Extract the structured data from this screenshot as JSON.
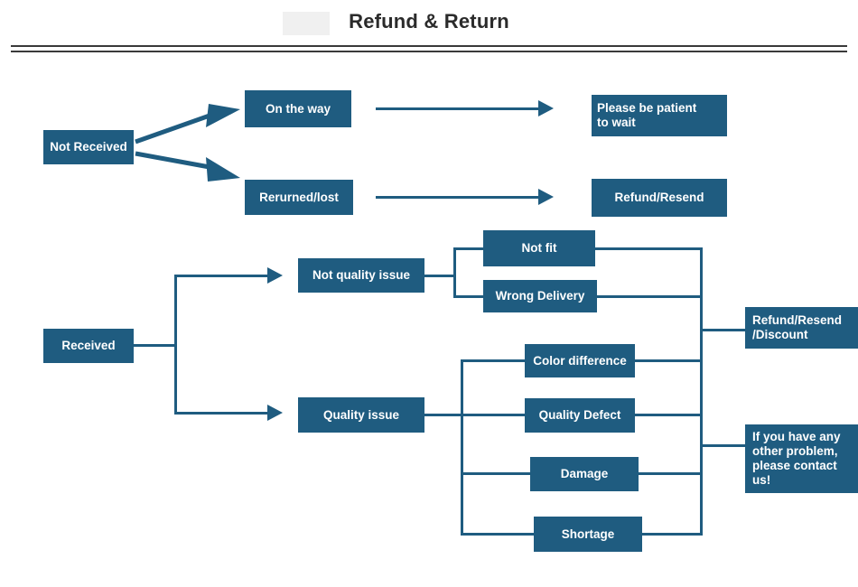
{
  "header": {
    "title": "Refund & Return"
  },
  "theme": {
    "node_fill": "#1f5c80",
    "node_text": "#ffffff",
    "connector": "#1f5c80",
    "rule": "#3a3a3a",
    "background": "#ffffff"
  },
  "diagram": {
    "type": "flowchart",
    "nodes": {
      "not_received": "Not Received",
      "on_the_way": "On the way",
      "returned_lost": "Rerurned/lost",
      "please_be_patient": "Please be patient\nto wait",
      "refund_resend": "Refund/Resend",
      "received": "Received",
      "not_quality_issue": "Not quality issue",
      "quality_issue": "Quality issue",
      "not_fit": "Not fit",
      "wrong_delivery": "Wrong Delivery",
      "color_difference": "Color difference",
      "quality_defect": "Quality Defect",
      "damage": "Damage",
      "shortage": "Shortage",
      "refund_resend_discount": "Refund/Resend\n/Discount",
      "contact_us": "If you have any\n other problem,\nplease contact\nus!"
    },
    "edges": [
      {
        "from": "not_received",
        "to": "on_the_way",
        "style": "diagonal-arrow"
      },
      {
        "from": "not_received",
        "to": "returned_lost",
        "style": "diagonal-arrow"
      },
      {
        "from": "on_the_way",
        "to": "please_be_patient",
        "style": "straight-arrow"
      },
      {
        "from": "returned_lost",
        "to": "refund_resend",
        "style": "straight-arrow"
      },
      {
        "from": "received",
        "to": "not_quality_issue",
        "style": "orthogonal-arrow"
      },
      {
        "from": "received",
        "to": "quality_issue",
        "style": "orthogonal-arrow"
      },
      {
        "from": "not_quality_issue",
        "to": "not_fit",
        "style": "bracket"
      },
      {
        "from": "not_quality_issue",
        "to": "wrong_delivery",
        "style": "bracket"
      },
      {
        "from": "quality_issue",
        "to": "color_difference",
        "style": "bracket"
      },
      {
        "from": "quality_issue",
        "to": "quality_defect",
        "style": "bracket"
      },
      {
        "from": "quality_issue",
        "to": "damage",
        "style": "bracket"
      },
      {
        "from": "quality_issue",
        "to": "shortage",
        "style": "bracket"
      },
      {
        "from": "not_fit",
        "to": "refund_resend_discount",
        "style": "bus"
      },
      {
        "from": "wrong_delivery",
        "to": "refund_resend_discount",
        "style": "bus"
      },
      {
        "from": "color_difference",
        "to": "refund_resend_discount",
        "style": "bus"
      },
      {
        "from": "quality_defect",
        "to": "contact_us",
        "style": "bus"
      },
      {
        "from": "damage",
        "to": "contact_us",
        "style": "bus"
      },
      {
        "from": "shortage",
        "to": "contact_us",
        "style": "bus"
      }
    ]
  }
}
